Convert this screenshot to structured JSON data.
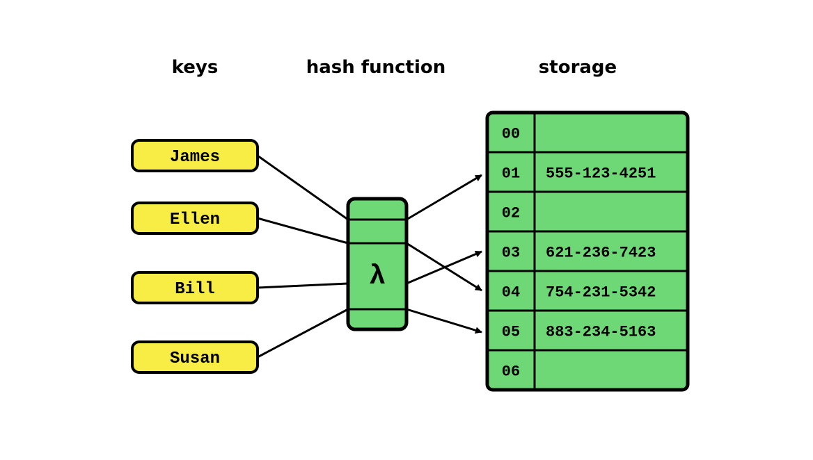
{
  "headings": {
    "keys": "keys",
    "hash": "hash function",
    "storage": "storage"
  },
  "keys": [
    "James",
    "Ellen",
    "Bill",
    "Susan"
  ],
  "hash_symbol": "λ",
  "storage": [
    {
      "index": "00",
      "value": ""
    },
    {
      "index": "01",
      "value": "555-123-4251"
    },
    {
      "index": "02",
      "value": ""
    },
    {
      "index": "03",
      "value": "621-236-7423"
    },
    {
      "index": "04",
      "value": "754-231-5342"
    },
    {
      "index": "05",
      "value": "883-234-5163"
    },
    {
      "index": "06",
      "value": ""
    }
  ],
  "colors": {
    "yellow": "#f7ed44",
    "green": "#6ed876",
    "stroke": "#000000"
  }
}
